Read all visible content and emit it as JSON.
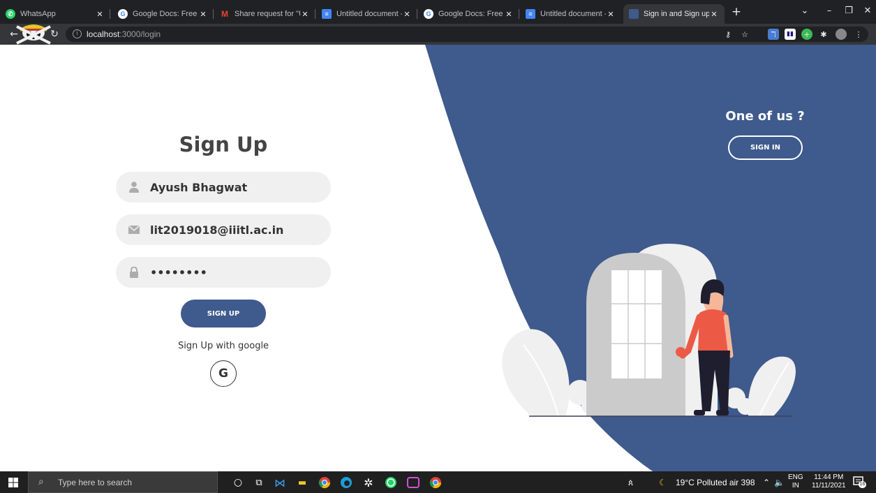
{
  "browser": {
    "tabs": [
      {
        "title": "WhatsApp",
        "icon": "whatsapp-icon",
        "color": "#25d366"
      },
      {
        "title": "Google Docs: Free On",
        "icon": "google-icon",
        "color": "#4285f4"
      },
      {
        "title": "Share request for \"Un",
        "icon": "gmail-icon",
        "color": "#ea4335"
      },
      {
        "title": "Untitled document - G",
        "icon": "docs-icon",
        "color": "#4285f4"
      },
      {
        "title": "Google Docs: Free On",
        "icon": "google-icon",
        "color": "#4285f4"
      },
      {
        "title": "Untitled document - G",
        "icon": "docs-icon",
        "color": "#4285f4"
      },
      {
        "title": "Sign in and Sign up",
        "icon": "site-icon",
        "color": "#3f5a8c"
      }
    ],
    "address": {
      "host": "localhost",
      "rest": ":3000/login"
    }
  },
  "signup": {
    "title": "Sign Up",
    "name_value": "Ayush Bhagwat",
    "email_value": "lit2019018@iiitl.ac.in",
    "password_value": "••••••••",
    "submit_label": "SIGN UP",
    "google_text": "Sign Up with google",
    "google_letter": "G"
  },
  "panel": {
    "heading": "One of us ?",
    "signin_label": "SIGN IN"
  },
  "colors": {
    "accent": "#3f5a8c",
    "field_bg": "#f0f0f0",
    "shirt": "#ec5a45"
  },
  "taskbar": {
    "search_placeholder": "Type here to search",
    "weather": "19°C  Polluted air 398",
    "lang_top": "ENG",
    "lang_bottom": "IN",
    "time": "11:44 PM",
    "date": "11/11/2021",
    "notifications": "16"
  }
}
